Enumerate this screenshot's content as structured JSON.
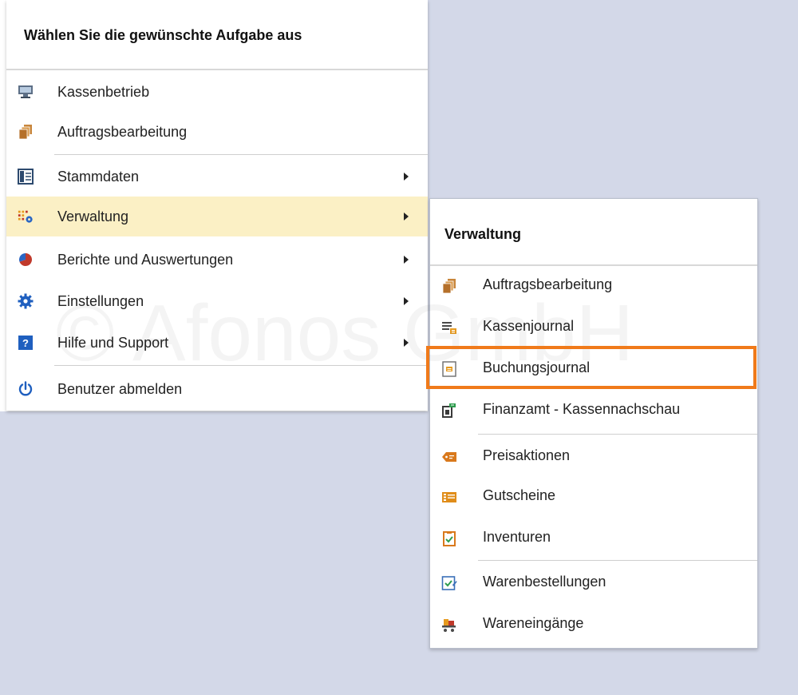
{
  "main_menu": {
    "title": "Wählen Sie die gewünschte Aufgabe aus",
    "items": [
      {
        "label": "Kassenbetrieb",
        "icon": "register-icon"
      },
      {
        "label": "Auftragsbearbeitung",
        "icon": "orders-icon"
      },
      {
        "label": "Stammdaten",
        "icon": "master-data-icon",
        "has_submenu": true
      },
      {
        "label": "Verwaltung",
        "icon": "administration-icon",
        "has_submenu": true,
        "active": true
      },
      {
        "label": "Berichte und Auswertungen",
        "icon": "pie-chart-icon",
        "has_submenu": true
      },
      {
        "label": "Einstellungen",
        "icon": "gear-icon",
        "has_submenu": true
      },
      {
        "label": "Hilfe und Support",
        "icon": "help-icon",
        "has_submenu": true
      },
      {
        "label": "Benutzer abmelden",
        "icon": "power-icon"
      }
    ]
  },
  "submenu": {
    "title": "Verwaltung",
    "items": [
      {
        "label": "Auftragsbearbeitung",
        "icon": "orders-icon"
      },
      {
        "label": "Kassenjournal",
        "icon": "cash-journal-icon"
      },
      {
        "label": "Buchungsjournal",
        "icon": "booking-journal-icon",
        "highlighted": true
      },
      {
        "label": "Finanzamt - Kassennachschau",
        "icon": "tax-office-icon"
      },
      {
        "label": "Preisaktionen",
        "icon": "price-tag-icon"
      },
      {
        "label": "Gutscheine",
        "icon": "voucher-icon"
      },
      {
        "label": "Inventuren",
        "icon": "clipboard-icon"
      },
      {
        "label": "Warenbestellungen",
        "icon": "checklist-icon"
      },
      {
        "label": "Wareneingänge",
        "icon": "cart-icon"
      }
    ]
  },
  "watermark": "© Afonos GmbH",
  "colors": {
    "desktop": "#d3d8e8",
    "active_item": "#fbf0c5",
    "highlight_border": "#f07a1a"
  }
}
